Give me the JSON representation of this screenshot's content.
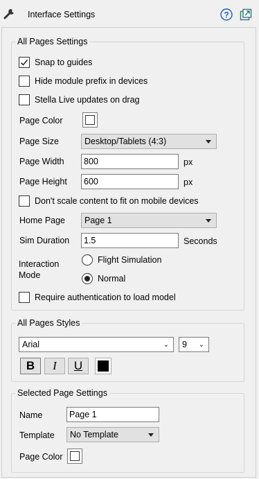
{
  "header": {
    "title": "Interface Settings"
  },
  "all_pages_settings": {
    "title": "All Pages Settings",
    "snap_to_guides": {
      "label": "Snap to guides",
      "checked": true
    },
    "hide_module_prefix": {
      "label": "Hide module prefix in devices",
      "checked": false
    },
    "stella_live_updates": {
      "label": "Stella Live updates on drag",
      "checked": false
    },
    "page_color_label": "Page Color",
    "page_size_label": "Page Size",
    "page_size_value": "Desktop/Tablets (4:3)",
    "page_width_label": "Page Width",
    "page_width_value": "800",
    "page_width_unit": "px",
    "page_height_label": "Page Height",
    "page_height_value": "600",
    "page_height_unit": "px",
    "dont_scale": {
      "label": "Don't scale content to fit on mobile devices",
      "checked": false
    },
    "home_page_label": "Home Page",
    "home_page_value": "Page 1",
    "sim_duration_label": "Sim Duration",
    "sim_duration_value": "1.5",
    "sim_duration_unit": "Seconds",
    "interaction_mode_label_1": "Interaction",
    "interaction_mode_label_2": "Mode",
    "interaction_modes": [
      {
        "label": "Flight Simulation",
        "selected": false
      },
      {
        "label": "Normal",
        "selected": true
      }
    ],
    "require_auth": {
      "label": "Require authentication to load model",
      "checked": false
    }
  },
  "all_pages_styles": {
    "title": "All Pages Styles",
    "font_family": "Arial",
    "font_size": "9",
    "bold_label": "B",
    "italic_label": "I",
    "underline_label": "U",
    "text_color": "#000000"
  },
  "selected_page_settings": {
    "title": "Selected Page Settings",
    "name_label": "Name",
    "name_value": "Page 1",
    "template_label": "Template",
    "template_value": "No Template",
    "page_color_label": "Page Color"
  },
  "colors": {
    "background": "#f0f0f0",
    "help_icon": "#1d5fb5"
  }
}
